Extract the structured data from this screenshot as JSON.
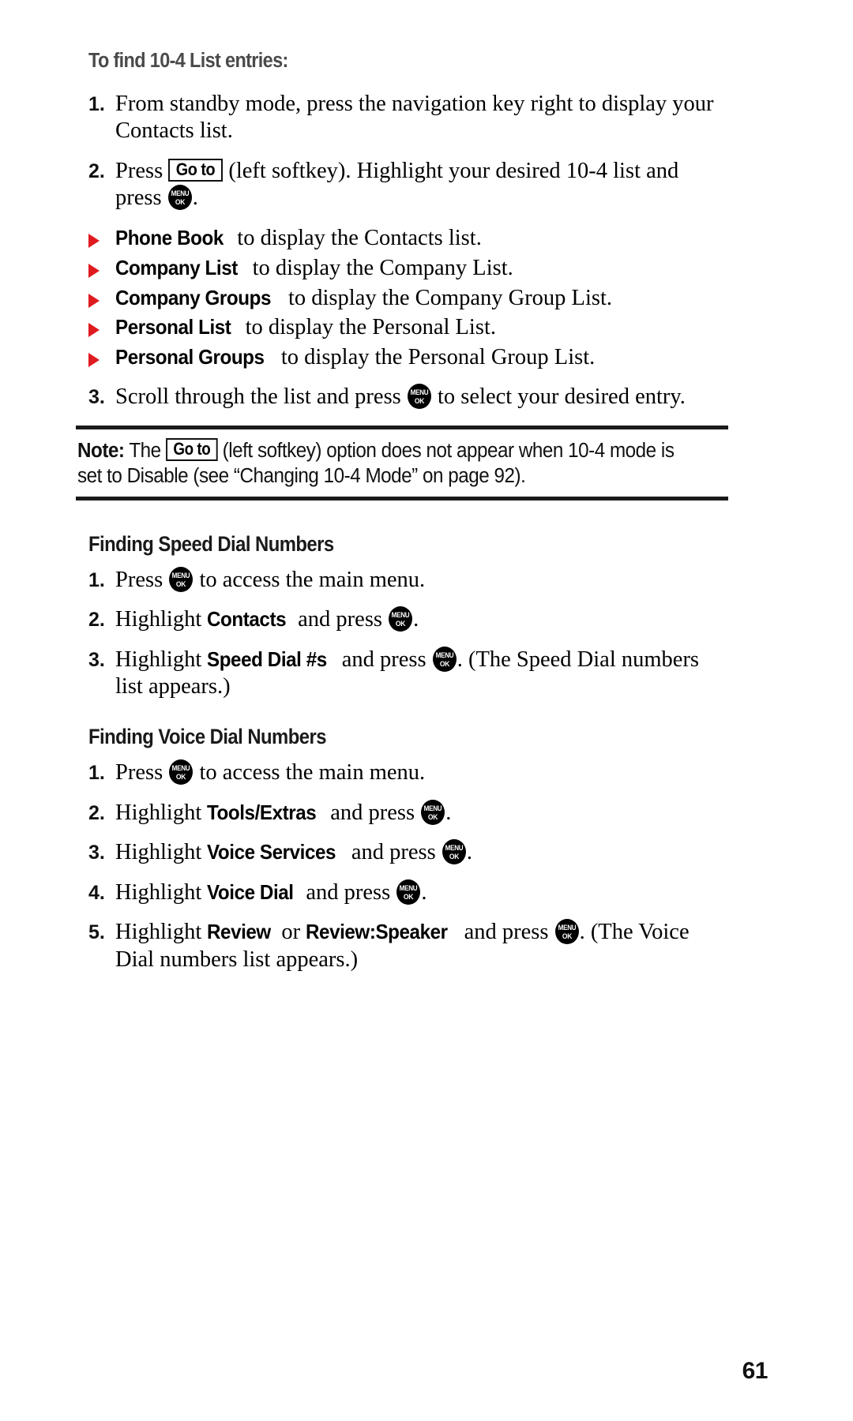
{
  "document": {
    "page_number": "61",
    "accent_color": "#e01b20",
    "key_glyph": {
      "top": "MENU",
      "bottom": "OK"
    },
    "softkey_label": "Go to"
  },
  "find_list": {
    "heading": "To find 10-4 List entries:",
    "steps": [
      {
        "num": "1.",
        "parts": [
          {
            "t": "text",
            "v": "From standby mode, press the navigation key right to display your Contacts list."
          }
        ]
      },
      {
        "num": "2.",
        "parts": [
          {
            "t": "text",
            "v": "Press "
          },
          {
            "t": "softkey",
            "v": "Go to"
          },
          {
            "t": "text",
            "v": " (left softkey). Highlight your desired 10-4 list and press "
          },
          {
            "t": "key",
            "v": "MENU OK"
          },
          {
            "t": "text",
            "v": "."
          }
        ]
      }
    ],
    "bullets": [
      {
        "name": "Phone Book",
        "desc": " to display the Contacts list."
      },
      {
        "name": "Company List",
        "desc": " to display the Company List."
      },
      {
        "name": "Company Groups",
        "desc": " to display the Company Group List."
      },
      {
        "name": "Personal List",
        "desc": " to display the Personal List."
      },
      {
        "name": "Personal Groups",
        "desc": " to display the Personal Group List."
      }
    ],
    "final_step": {
      "num": "3.",
      "pre": "Scroll through the list and press ",
      "post": " to select your desired entry."
    }
  },
  "note": {
    "label": "Note:",
    "pre": " The ",
    "softkey": "Go to",
    "post": " (left softkey) option does not appear when 10-4 mode is set to Disable (see “Changing 10-4 Mode” on page 92)."
  },
  "speed_dial": {
    "heading": "Finding Speed Dial Numbers",
    "steps": [
      {
        "num": "1.",
        "pre": "Press ",
        "bold": "",
        "mid": "",
        "post": " to access the main menu."
      },
      {
        "num": "2.",
        "pre": "Highlight ",
        "bold": "Contacts",
        "mid": " and press ",
        "post": "."
      },
      {
        "num": "3.",
        "pre": "Highlight ",
        "bold": "Speed Dial #s",
        "mid": " and press ",
        "post": ". (The Speed Dial numbers list appears.)"
      }
    ]
  },
  "voice_dial": {
    "heading": "Finding Voice Dial Numbers",
    "steps": [
      {
        "num": "1.",
        "pre": "Press ",
        "bold": "",
        "mid": "",
        "post": " to access the main menu."
      },
      {
        "num": "2.",
        "pre": "Highlight ",
        "bold": "Tools/Extras",
        "mid": " and press ",
        "post": "."
      },
      {
        "num": "3.",
        "pre": "Highlight ",
        "bold": "Voice Services",
        "mid": " and press ",
        "post": "."
      },
      {
        "num": "4.",
        "pre": "Highlight ",
        "bold": "Voice Dial",
        "mid": " and press ",
        "post": "."
      },
      {
        "num": "5.",
        "pre": "Highlight ",
        "bold": "Review",
        "mid2": " or ",
        "bold2": "Review:Speaker",
        "mid": " and press ",
        "post": ". (The Voice Dial numbers list appears.)"
      }
    ]
  }
}
